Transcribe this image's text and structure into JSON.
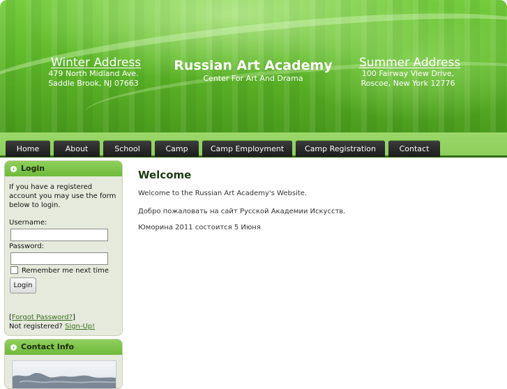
{
  "header": {
    "winter": {
      "heading": "Winter Address",
      "line1": "479 North Midland Ave.",
      "line2": "Saddle Brook, NJ 07663"
    },
    "title": "Russian Art Academy",
    "subtitle": "Center For Art And Drama",
    "summer": {
      "heading": "Summer Address",
      "line1": "100 Fairway View Drive,",
      "line2": "Roscoe, New York 12776"
    }
  },
  "nav": {
    "items": [
      {
        "label": "Home"
      },
      {
        "label": "About"
      },
      {
        "label": "School"
      },
      {
        "label": "Camp"
      },
      {
        "label": "Camp Employment"
      },
      {
        "label": "Camp Registration"
      },
      {
        "label": "Contact"
      }
    ]
  },
  "login": {
    "title": "Login",
    "intro": "If you have a registered account you may use the form below to login.",
    "username_label": "Username:",
    "username_value": "",
    "password_label": "Password:",
    "password_value": "",
    "remember_label": "Remember me next time",
    "button_label": "Login",
    "forgot_open": "[",
    "forgot_link": "Forgot Password?",
    "forgot_close": "]",
    "not_registered": "Not registered?",
    "signup_link": "Sign-Up!"
  },
  "contact": {
    "title": "Contact Info"
  },
  "main": {
    "welcome_title": "Welcome",
    "paragraph1": "Welcome to the Russian Art Academy's Website.",
    "paragraph2": "Добро пожаловать на сайт Русской Академии Искусств.",
    "paragraph3": "Юморина 2011 состоится 5 Июня"
  },
  "colors": {
    "accent_green": "#6fba3b",
    "nav_dark": "#1c1c1c",
    "link_green": "#3a6d1f"
  }
}
